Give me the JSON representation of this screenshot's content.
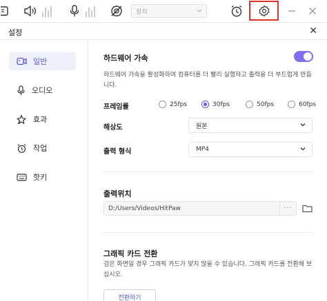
{
  "toolbar": {
    "device_placeholder": "장치"
  },
  "dialog": {
    "title": "설정",
    "close_glyph": "✕"
  },
  "sidebar": {
    "items": [
      {
        "label": "일반",
        "icon": "video-camera-icon",
        "active": true
      },
      {
        "label": "오디오",
        "icon": "microphone-icon",
        "active": false
      },
      {
        "label": "효과",
        "icon": "sparkle-icon",
        "active": false
      },
      {
        "label": "작업",
        "icon": "alarm-clock-icon",
        "active": false
      },
      {
        "label": "핫키",
        "icon": "keyboard-icon",
        "active": false
      }
    ]
  },
  "general": {
    "hw_accel": {
      "title": "하드웨어 가속",
      "enabled": true,
      "description": "하드웨어 가속을 활성화하여 컴퓨터를 더 빨리 실행하고 출력을 더 부드럽게 만듭니다."
    },
    "framerate": {
      "label": "프레임률",
      "options": [
        "25fps",
        "30fps",
        "50fps",
        "60fps"
      ],
      "selected": "30fps"
    },
    "resolution": {
      "label": "해상도",
      "value": "원본"
    },
    "output_format": {
      "label": "출력 형식",
      "value": "MP4"
    },
    "output_location": {
      "title": "출력위치",
      "path": "D:/Users/Videos/HitPaw",
      "more_glyph": "···"
    },
    "gpu_switch": {
      "title": "그래픽 카드 전환",
      "description": "검은 화면일 경우 그래픽 카드가 맞지 않을 수 있습니다. 그래픽 카드를 전환해 보십시오.",
      "button_label": "전환하기"
    }
  },
  "colors": {
    "accent": "#6257e8",
    "toggle_on": "#7d6ff0",
    "highlight_box": "#e0332c",
    "active_bg": "#eef0fb"
  }
}
